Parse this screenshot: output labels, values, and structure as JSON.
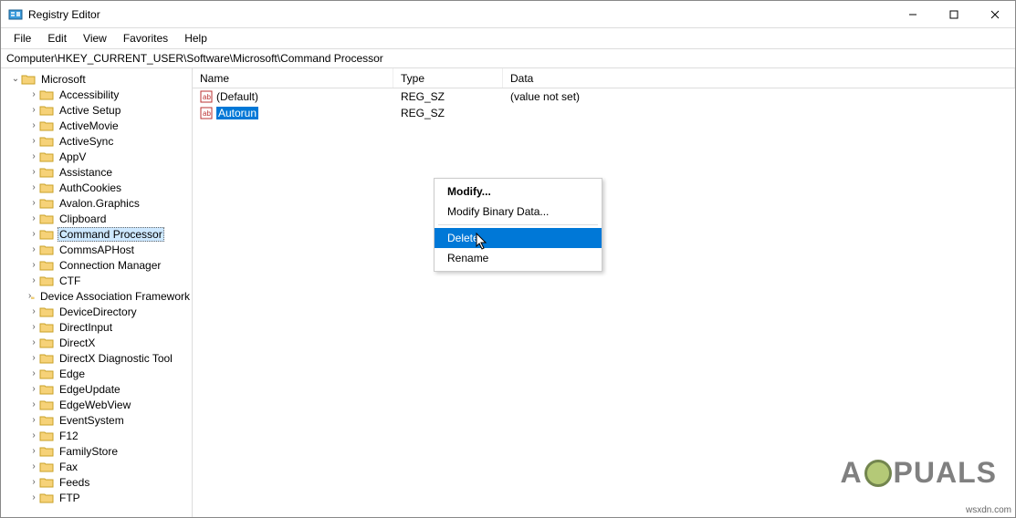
{
  "window": {
    "title": "Registry Editor"
  },
  "menu": {
    "file": "File",
    "edit": "Edit",
    "view": "View",
    "favorites": "Favorites",
    "help": "Help"
  },
  "addressbar": {
    "path": "Computer\\HKEY_CURRENT_USER\\Software\\Microsoft\\Command Processor"
  },
  "columns": {
    "name": "Name",
    "type": "Type",
    "data": "Data"
  },
  "tree": {
    "parent": "Microsoft",
    "items": [
      "Accessibility",
      "Active Setup",
      "ActiveMovie",
      "ActiveSync",
      "AppV",
      "Assistance",
      "AuthCookies",
      "Avalon.Graphics",
      "Clipboard",
      "Command Processor",
      "CommsAPHost",
      "Connection Manager",
      "CTF",
      "Device Association Framework",
      "DeviceDirectory",
      "DirectInput",
      "DirectX",
      "DirectX Diagnostic Tool",
      "Edge",
      "EdgeUpdate",
      "EdgeWebView",
      "EventSystem",
      "F12",
      "FamilyStore",
      "Fax",
      "Feeds",
      "FTP"
    ],
    "selected": "Command Processor"
  },
  "values": [
    {
      "name": "(Default)",
      "type": "REG_SZ",
      "data": "(value not set)",
      "selected": false
    },
    {
      "name": "Autorun",
      "type": "REG_SZ",
      "data": "",
      "selected": true
    }
  ],
  "context_menu": {
    "modify": "Modify...",
    "modify_binary": "Modify Binary Data...",
    "delete": "Delete",
    "rename": "Rename",
    "highlighted": "delete"
  },
  "watermark": {
    "pre": "A",
    "post": "PUALS"
  },
  "credit": "wsxdn.com"
}
